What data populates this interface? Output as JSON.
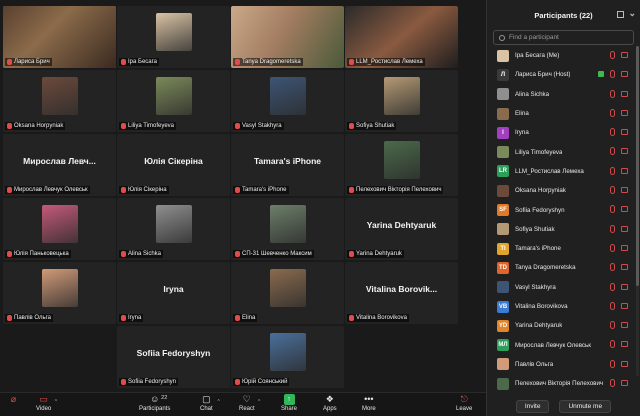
{
  "tiles": [
    {
      "name": "Лариса Брич",
      "kind": "video",
      "active": true
    },
    {
      "name": "Іра Бесага",
      "kind": "photo",
      "photo_color": "#d9c3a4"
    },
    {
      "name": "Tanya Dragomeretska",
      "kind": "video"
    },
    {
      "name": "LLM_Ростислав Лемеха",
      "kind": "video"
    },
    {
      "name": "Oksana Horpyniak",
      "kind": "photo",
      "photo_color": "#6b4a3c"
    },
    {
      "name": "Liliya Timofeyeva",
      "kind": "photo",
      "photo_color": "#7b8a5a"
    },
    {
      "name": "Vasyl Stakhyra",
      "kind": "photo",
      "photo_color": "#3d5575"
    },
    {
      "name": "Sofiya Shutiak",
      "kind": "photo",
      "photo_color": "#b49a74"
    },
    {
      "name": "Мирослав Левчук Олевськ",
      "kind": "name",
      "big": "Мирослав  Левч..."
    },
    {
      "name": "Юлія Сікеріна",
      "kind": "name",
      "big": "Юлія Сікеріна"
    },
    {
      "name": "Tamara's iPhone",
      "kind": "name",
      "big": "Tamara's iPhone"
    },
    {
      "name": "Пелехович Вікторія Пелехович",
      "kind": "photo",
      "photo_color": "#4b6a4a"
    },
    {
      "name": "Юлія Паньковецька",
      "kind": "photo",
      "photo_color": "#c45a7a"
    },
    {
      "name": "Alina Sichka",
      "kind": "photo",
      "photo_color": "#8f8f8f"
    },
    {
      "name": "СП-31 Шевченко Максим",
      "kind": "photo",
      "photo_color": "#6d7f6a"
    },
    {
      "name": "Yarina Dehtyaruk",
      "kind": "name",
      "big": "Yarina Dehtyaruk"
    },
    {
      "name": "Павлів Ольга",
      "kind": "photo",
      "photo_color": "#d19a78"
    },
    {
      "name": "Iryna",
      "kind": "name",
      "big": "Iryna"
    },
    {
      "name": "Elina",
      "kind": "photo",
      "photo_color": "#8a6b4e"
    },
    {
      "name": "Vitalina Borovikova",
      "kind": "name",
      "big": "Vitalina  Borovik..."
    },
    {
      "name": "Sofiia Fedoryshyn",
      "kind": "name",
      "big": "Sofiia Fedoryshyn"
    },
    {
      "name": "Юрій Соянський",
      "kind": "photo",
      "photo_color": "#4a6f9a"
    }
  ],
  "panel": {
    "title": "Participants (22)",
    "search_placeholder": "Find a participant",
    "participants": [
      {
        "name": "Іра Бесага (Me)",
        "avatar": "",
        "color": "#d9c3a4"
      },
      {
        "name": "Лариса Брич (Host)",
        "avatar": "Л",
        "color": "#3a3a3a",
        "host": true
      },
      {
        "name": "Alina Sichka",
        "avatar": "",
        "color": "#8f8f8f"
      },
      {
        "name": "Elina",
        "avatar": "",
        "color": "#8a6b4e"
      },
      {
        "name": "Iryna",
        "avatar": "I",
        "color": "#a23fbf"
      },
      {
        "name": "Liliya Timofeyeva",
        "avatar": "",
        "color": "#7b8a5a"
      },
      {
        "name": "LLM_Ростислав Лемеха",
        "avatar": "LR",
        "color": "#2e9e5b"
      },
      {
        "name": "Oksana Horpyniak",
        "avatar": "",
        "color": "#6b4a3c"
      },
      {
        "name": "Sofiia Fedoryshyn",
        "avatar": "SF",
        "color": "#e07a2a"
      },
      {
        "name": "Sofiya Shutiak",
        "avatar": "",
        "color": "#b49a74"
      },
      {
        "name": "Tamara's iPhone",
        "avatar": "TI",
        "color": "#e0a52a"
      },
      {
        "name": "Tanya Dragomeretska",
        "avatar": "TD",
        "color": "#e0652a"
      },
      {
        "name": "Vasyl Stakhyra",
        "avatar": "",
        "color": "#3d5575"
      },
      {
        "name": "Vitalina Borovikova",
        "avatar": "VB",
        "color": "#3a7bd5"
      },
      {
        "name": "Yarina Dehtyaruk",
        "avatar": "YD",
        "color": "#e0852a"
      },
      {
        "name": "Мирослав Левчук Олевськ",
        "avatar": "МЛ",
        "color": "#2e9e5b"
      },
      {
        "name": "Павлів Ольга",
        "avatar": "",
        "color": "#d19a78"
      },
      {
        "name": "Пелехович Вікторія Пелехович",
        "avatar": "",
        "color": "#4b6a4a"
      }
    ],
    "invite_label": "Invite",
    "mute_label": "Unmute me"
  },
  "toolbar": {
    "video": "Video",
    "participants": "Participants",
    "participants_count": "22",
    "chat": "Chat",
    "react": "React",
    "share": "Share",
    "apps": "Apps",
    "more": "More",
    "leave": "Leave"
  }
}
